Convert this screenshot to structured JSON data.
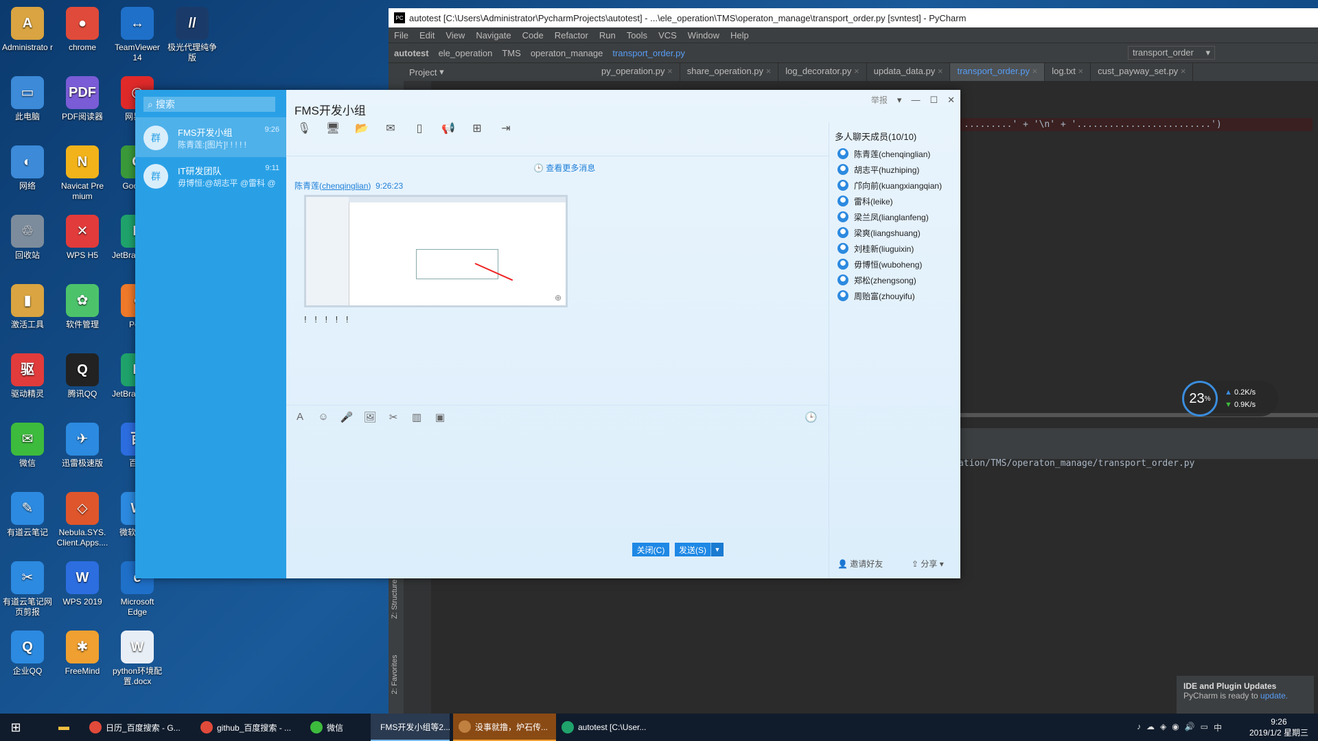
{
  "desktop": {
    "icons": [
      {
        "label": "Administrato r",
        "color": "#d9a441",
        "text": "A"
      },
      {
        "label": "chrome",
        "color": "#e04a3a",
        "text": "●"
      },
      {
        "label": "TeamViewer 14",
        "color": "#1f70c9",
        "text": "↔"
      },
      {
        "label": "极光代理纯争版",
        "color": "#1a3b6a",
        "text": "//"
      },
      {
        "label": "此电脑",
        "color": "#3c8ad8",
        "text": "▭"
      },
      {
        "label": "PDF阅读器",
        "color": "#7a5cd6",
        "text": "PDF"
      },
      {
        "label": "网易云",
        "color": "#e02a2a",
        "text": "◎"
      },
      {
        "label": "网络",
        "color": "#3c8ad8",
        "text": "◐"
      },
      {
        "label": "Navicat Pre mium",
        "color": "#f2b31a",
        "text": "N"
      },
      {
        "label": "Goog or",
        "color": "#3a9a3a",
        "text": "G"
      },
      {
        "label": "回收站",
        "color": "#7d8c9c",
        "text": "♲"
      },
      {
        "label": "WPS H5",
        "color": "#e23b3b",
        "text": "✕"
      },
      {
        "label": "JetBra Charm",
        "color": "#1fa36b",
        "text": "P"
      },
      {
        "label": "激活工具",
        "color": "#d9a441",
        "text": "▮"
      },
      {
        "label": "软件管理",
        "color": "#4cc36b",
        "text": "✿"
      },
      {
        "label": "Post",
        "color": "#f07a2a",
        "text": "●"
      },
      {
        "label": "驱动精灵",
        "color": "#e23b3b",
        "text": "驱"
      },
      {
        "label": "腾讯QQ",
        "color": "#222",
        "text": "Q"
      },
      {
        "label": "JetBra Charm",
        "color": "#1fa36b",
        "text": "P"
      },
      {
        "label": "微信",
        "color": "#3dbb3d",
        "text": "✉"
      },
      {
        "label": "迅雷极速版",
        "color": "#2c8ae0",
        "text": "✈"
      },
      {
        "label": "百度",
        "color": "#2c6de0",
        "text": "百"
      },
      {
        "label": "有道云笔记",
        "color": "#2c8ae0",
        "text": "✎"
      },
      {
        "label": "Nebula.SYS. Client.Apps....",
        "color": "#e0562c",
        "text": "◇"
      },
      {
        "label": "微软 ws 1",
        "color": "#2c8ae0",
        "text": "W"
      },
      {
        "label": "有道云笔记网页剪报",
        "color": "#2c8ae0",
        "text": "✂"
      },
      {
        "label": "WPS 2019",
        "color": "#2c6de0",
        "text": "W"
      },
      {
        "label": "Microsoft Edge",
        "color": "#1f70c9",
        "text": "e"
      },
      {
        "label": "企业QQ",
        "color": "#2c8ae0",
        "text": "Q"
      },
      {
        "label": "FreeMind",
        "color": "#f0a030",
        "text": "✱"
      },
      {
        "label": "python环境配置.docx",
        "color": "#e8eef6",
        "text": "W"
      }
    ]
  },
  "pycharm": {
    "title": "autotest [C:\\Users\\Administrator\\PycharmProjects\\autotest] - ...\\ele_operation\\TMS\\operaton_manage\\transport_order.py [svntest] - PyCharm",
    "menu": [
      "File",
      "Edit",
      "View",
      "Navigate",
      "Code",
      "Refactor",
      "Run",
      "Tools",
      "VCS",
      "Window",
      "Help"
    ],
    "nav": [
      "autotest",
      "ele_operation",
      "TMS",
      "operaton_manage",
      "transport_order.py"
    ],
    "run_config": "transport_order",
    "project_label": "Project",
    "tabs": [
      "py_operation.py",
      "share_operation.py",
      "log_decorator.py",
      "updata_data.py",
      "transport_order.py",
      "log.txt",
      "cust_payway_set.py"
    ],
    "active_tab": "transport_order.py",
    "code_line": ".........' + '\\n' + '.........................')",
    "path_line": "ation/TMS/operaton_manage/transport_order.py",
    "structure_label": "Z: Structure",
    "favorites_label": "2: Favorites",
    "notice_title": "IDE and Plugin Updates",
    "notice_body": "PyCharm is ready to",
    "notice_link": "update."
  },
  "speed": {
    "percent": "23",
    "unit": "%",
    "up": "0.2K/s",
    "down": "0.9K/s"
  },
  "qq": {
    "search_placeholder": "搜索",
    "chats": [
      {
        "name": "FMS开发小组",
        "preview": "陈青莲:[图片]! ! ! ! !",
        "time": "9:26"
      },
      {
        "name": "IT研发团队",
        "preview": "毋博恒:@胡志平 @雷科 @",
        "time": "9:11"
      }
    ],
    "window_title": "FMS开发小组",
    "report_label": "举报",
    "more_messages": "查看更多消息",
    "message": {
      "sender": "陈青莲",
      "sender_id": "chenqinglian",
      "time": "9:26:23",
      "text": "! ! ! ! !"
    },
    "close_btn": "关闭(C)",
    "send_btn": "发送(S)",
    "members_title": "多人聊天成员(10/10)",
    "members": [
      "陈青莲(chenqinglian)",
      "胡志平(huzhiping)",
      "邝向前(kuangxiangqian)",
      "雷科(leike)",
      "梁兰凤(lianglanfeng)",
      "梁爽(liangshuang)",
      "刘桂新(liuguixin)",
      "毋博恒(wuboheng)",
      "郑松(zhengsong)",
      "周贻富(zhouyifu)"
    ],
    "invite_label": "邀请好友",
    "share_label": "分享"
  },
  "taskbar": {
    "items": [
      {
        "label": "日历_百度搜索 - G...",
        "color": "#e04a3a"
      },
      {
        "label": "github_百度搜索 - ...",
        "color": "#e04a3a"
      },
      {
        "label": "微信",
        "color": "#3dbb3d"
      },
      {
        "label": "FMS开发小组等2...",
        "color": "#2c8ae0"
      },
      {
        "label": "没事就撸，炉石传...",
        "color": "#c08040"
      },
      {
        "label": "autotest [C:\\User...",
        "color": "#1fa36b"
      }
    ],
    "time": "9:26",
    "date": "2019/1/2 星期三",
    "ime": "中"
  }
}
